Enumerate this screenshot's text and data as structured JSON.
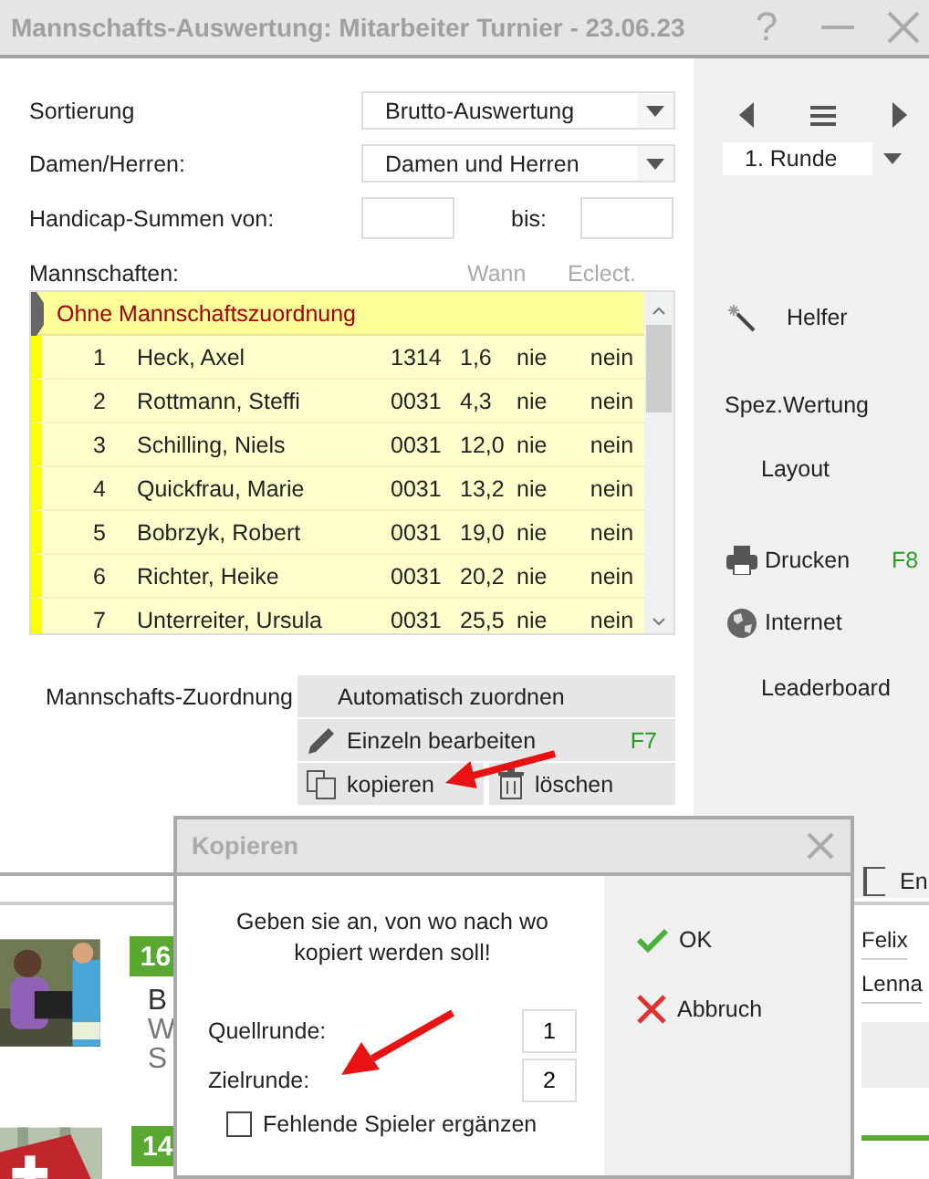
{
  "window": {
    "title": "Mannschafts-Auswertung: Mitarbeiter Turnier - 23.06.23",
    "help": "?"
  },
  "form": {
    "fields": [
      {
        "kind": "dropdown",
        "label": "Sortierung",
        "value": "Brutto-Auswertung"
      },
      {
        "kind": "dropdown",
        "label": "Damen/Herren:",
        "value": "Damen und Herren"
      },
      {
        "kind": "range",
        "label": "Handicap-Summen von:",
        "to_label": "bis:"
      }
    ]
  },
  "teams": {
    "label": "Mannschaften:",
    "columns": [
      "Wann",
      "Eclect."
    ],
    "group": "Ohne Mannschaftszuordnung",
    "rows": [
      {
        "number": "1",
        "name": "Heck, Axel",
        "column_3": "1314",
        "column_4": "1,6",
        "wann": "nie",
        "eclect": "nein"
      },
      {
        "number": "2",
        "name": "Rottmann, Steffi",
        "column_3": "0031",
        "column_4": "4,3",
        "wann": "nie",
        "eclect": "nein"
      },
      {
        "number": "3",
        "name": "Schilling, Niels",
        "column_3": "0031",
        "column_4": "12,0",
        "wann": "nie",
        "eclect": "nein"
      },
      {
        "number": "4",
        "name": "Quickfrau, Marie",
        "column_3": "0031",
        "column_4": "13,2",
        "wann": "nie",
        "eclect": "nein"
      },
      {
        "number": "5",
        "name": "Bobrzyk, Robert",
        "column_3": "0031",
        "column_4": "19,0",
        "wann": "nie",
        "eclect": "nein"
      },
      {
        "number": "6",
        "name": "Richter, Heike",
        "column_3": "0031",
        "column_4": "20,2",
        "wann": "nie",
        "eclect": "nein"
      },
      {
        "number": "7",
        "name": "Unterreiter, Ursula",
        "column_3": "0031",
        "column_4": "25,5",
        "wann": "nie",
        "eclect": "nein"
      }
    ]
  },
  "assignment": {
    "label": "Mannschafts-Zuordnung",
    "buttons": [
      {
        "kind": "plain",
        "label": "Automatisch zuordnen"
      },
      {
        "kind": "edit",
        "label": "Einzeln bearbeiten",
        "shortcut": "F7"
      },
      {
        "kind": "copy",
        "label": "kopieren"
      },
      {
        "kind": "delete",
        "label": "löschen"
      }
    ]
  },
  "side_panel": {
    "round": "1. Runde",
    "actions": [
      {
        "kind": "wand",
        "label": "Helfer"
      },
      {
        "kind": "plain",
        "label": "Spez.Wertung"
      },
      {
        "kind": "indented",
        "label": "Layout"
      },
      {
        "kind": "print",
        "label": "Drucken",
        "shortcut": "F8"
      },
      {
        "kind": "globe",
        "label": "Internet"
      },
      {
        "kind": "indented",
        "label": "Leaderboard"
      },
      {
        "kind": "exit",
        "label": "En"
      }
    ]
  },
  "background_page": {
    "cards": [
      {
        "badge": "16",
        "lines": [
          "B",
          "W",
          "S"
        ]
      },
      {
        "badge": "14"
      }
    ],
    "entries": [
      "Felix",
      "Lenna"
    ]
  },
  "dialog": {
    "title": "Kopieren",
    "message": "Geben sie an, von wo nach wo kopiert werden soll!",
    "fields": [
      {
        "label": "Quellrunde:",
        "value": "1"
      },
      {
        "label": "Zielrunde:",
        "value": "2"
      }
    ],
    "checkbox": {
      "label": "Fehlende Spieler ergänzen",
      "checked": false
    },
    "buttons": [
      {
        "kind": "ok",
        "label": "OK"
      },
      {
        "kind": "cancel",
        "label": "Abbruch"
      }
    ]
  }
}
